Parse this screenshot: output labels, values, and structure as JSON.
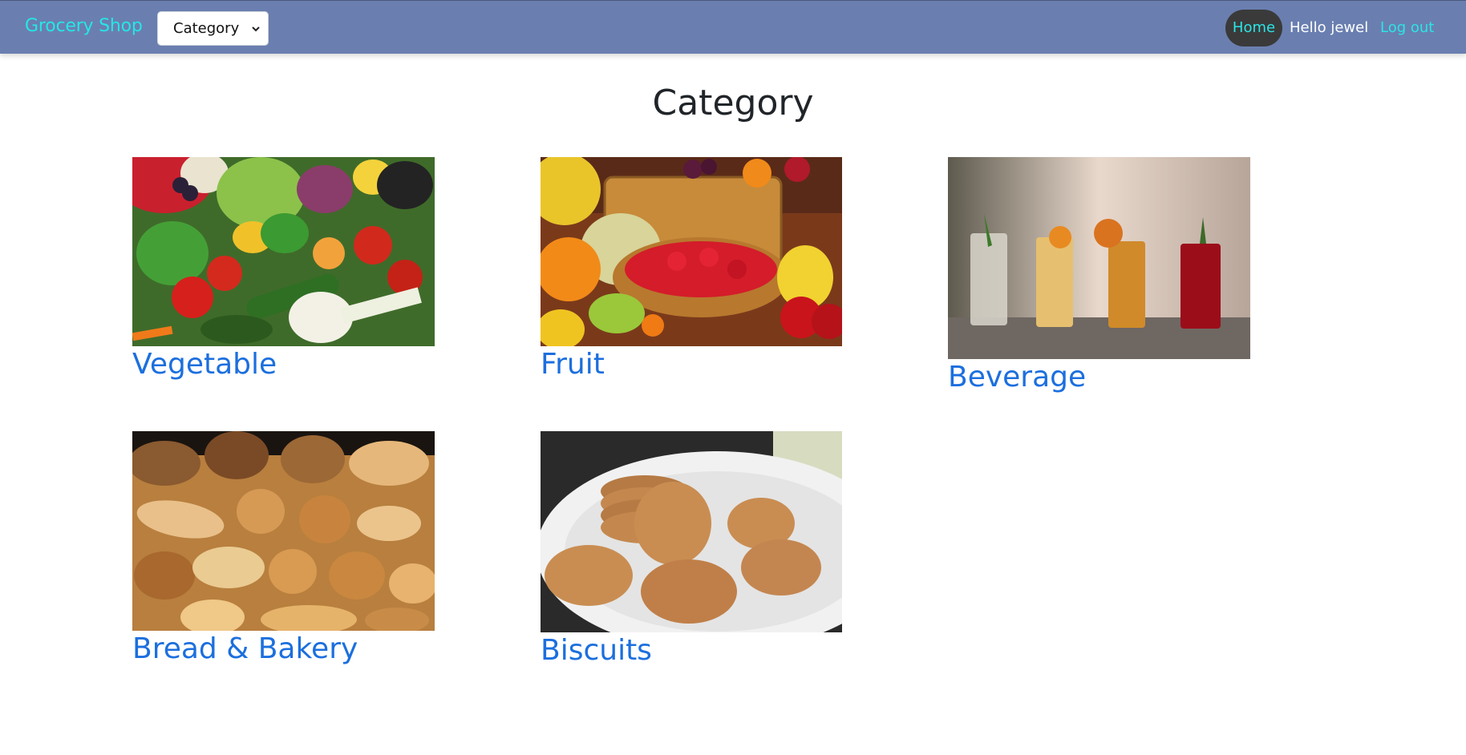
{
  "navbar": {
    "brand": "Grocery Shop",
    "category_select": {
      "selected": "Category"
    },
    "home_label": "Home",
    "greeting": "Hello jewel",
    "logout_label": "Log out"
  },
  "main": {
    "title": "Category",
    "categories": [
      {
        "label": "Vegetable",
        "image": "vegetables-photo"
      },
      {
        "label": "Fruit",
        "image": "fruit-basket-photo"
      },
      {
        "label": "Beverage",
        "image": "beverage-glasses-photo"
      },
      {
        "label": "Bread & Bakery",
        "image": "bread-assortment-photo"
      },
      {
        "label": "Biscuits",
        "image": "biscuits-plate-photo"
      }
    ]
  },
  "colors": {
    "navbar_bg": "#6a7fb0",
    "brand": "#25e6e6",
    "link_cyan": "#2ce4e6",
    "home_pill_bg": "#3a3a3a",
    "category_link": "#1c6fde"
  }
}
